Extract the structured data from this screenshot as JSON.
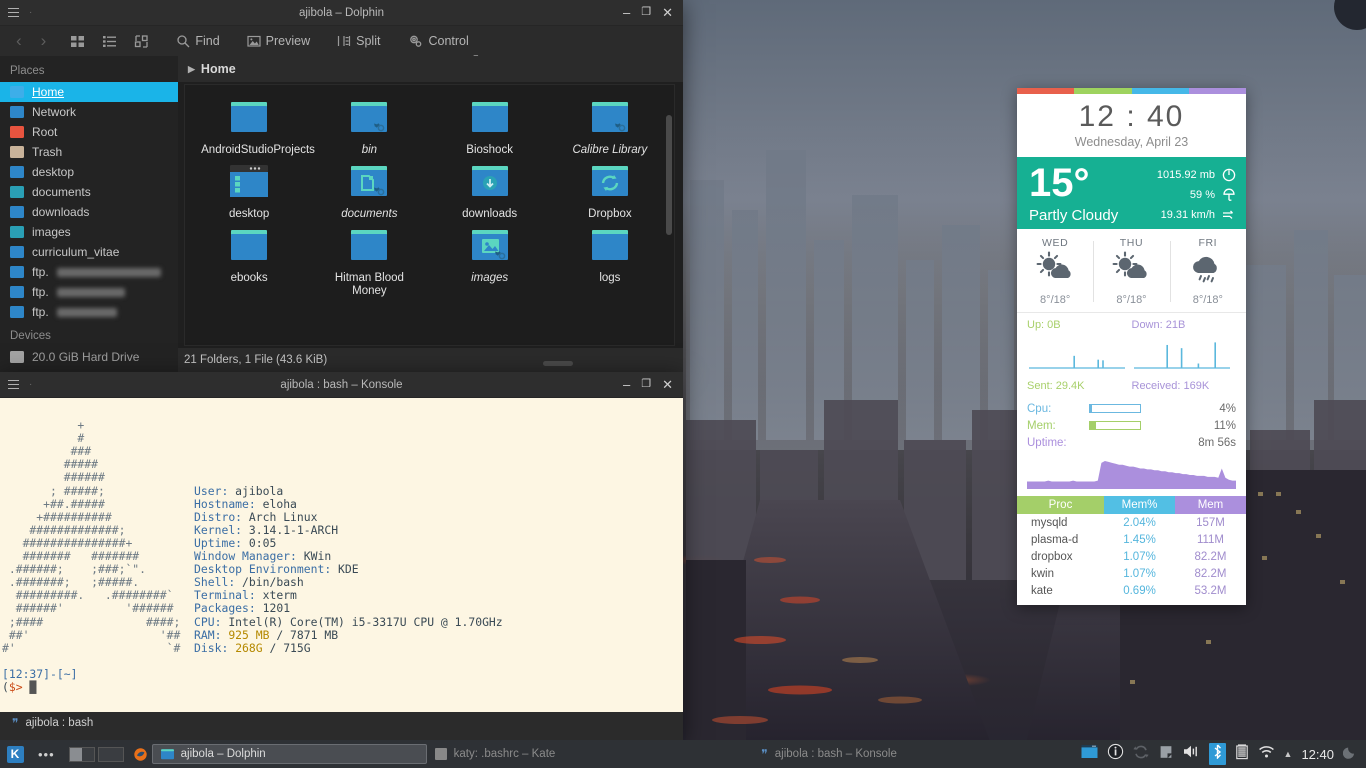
{
  "dolphin": {
    "title": "ajibola – Dolphin",
    "toolbar": {
      "back": "‹",
      "forward": "›",
      "icons_view": "grid-view-icon",
      "details_view": "details-view-icon",
      "sort_view": "sort-icon",
      "find": "Find",
      "preview": "Preview",
      "split": "Split",
      "control": "Control"
    },
    "breadcrumb": "Home",
    "places_header": "Places",
    "devices_header": "Devices",
    "places": [
      {
        "label": "Home",
        "color": "#3daee9",
        "selected": true
      },
      {
        "label": "Network",
        "color": "#2e86c8",
        "selected": false
      },
      {
        "label": "Root",
        "color": "#e8543f",
        "selected": false
      },
      {
        "label": "Trash",
        "color": "#c9b39a",
        "selected": false
      },
      {
        "label": "desktop",
        "color": "#2e86c8",
        "selected": false
      },
      {
        "label": "documents",
        "color": "#2a9fb5",
        "selected": false
      },
      {
        "label": "downloads",
        "color": "#2e86c8",
        "selected": false
      },
      {
        "label": "images",
        "color": "#2a9fb5",
        "selected": false
      },
      {
        "label": "curriculum_vitae",
        "color": "#2e86c8",
        "selected": false
      }
    ],
    "ftp_places": [
      {
        "label": "ftp.",
        "color": "#2e86c8",
        "redacted_width": 104
      },
      {
        "label": "ftp.",
        "color": "#2e86c8",
        "redacted_width": 68
      },
      {
        "label": "ftp.",
        "color": "#2e86c8",
        "redacted_width": 60
      }
    ],
    "device": {
      "label": "20.0 GiB Hard Drive"
    },
    "files": [
      {
        "name": "AndroidStudioProjects",
        "italic": false,
        "emblem": "none"
      },
      {
        "name": "bin",
        "italic": true,
        "emblem": "link"
      },
      {
        "name": "Bioshock",
        "italic": false,
        "emblem": "none"
      },
      {
        "name": "Calibre Library",
        "italic": true,
        "emblem": "link"
      },
      {
        "name": "desktop",
        "italic": false,
        "emblem": "desktop"
      },
      {
        "name": "documents",
        "italic": true,
        "emblem": "documents-link"
      },
      {
        "name": "downloads",
        "italic": false,
        "emblem": "download"
      },
      {
        "name": "Dropbox",
        "italic": false,
        "emblem": "sync"
      },
      {
        "name": "ebooks",
        "italic": false,
        "emblem": "none"
      },
      {
        "name": "Hitman Blood Money",
        "italic": false,
        "emblem": "none"
      },
      {
        "name": "images",
        "italic": true,
        "emblem": "images-link"
      },
      {
        "name": "logs",
        "italic": false,
        "emblem": "none"
      }
    ],
    "status": "21 Folders, 1 File (43.6 KiB)"
  },
  "konsole": {
    "title": "ajibola : bash – Konsole",
    "tab_label": "ajibola : bash",
    "sysinfo": {
      "User": "ajibola",
      "Hostname": "eloha",
      "Distro": "Arch Linux",
      "Kernel": "3.14.1-1-ARCH",
      "Uptime": "0:05",
      "Window Manager": "KWin",
      "Desktop Environment": "KDE",
      "Shell": "/bin/bash",
      "Terminal": "xterm",
      "Packages": "1201",
      "CPU": "Intel(R) Core(TM) i5-3317U CPU @ 1.70GHz",
      "RAM_used": "925 MB",
      "RAM_total": "7871 MB",
      "Disk_used": "268G",
      "Disk_total": "715G"
    },
    "prompt_time": "[12:37]-[~]",
    "prompt_sigil": "($> ",
    "ascii_art": [
      "           +",
      "           #",
      "          ###",
      "         #####",
      "         ######",
      "       ; #####;",
      "      +##.#####",
      "     +##########",
      "    #############;",
      "   ###############+",
      "   #######   #######",
      " .######;    ;###;`\".",
      " .#######;   ;#####.",
      "  #########.   .########`",
      "  ######'         '######",
      " ;####               ####;",
      " ##'                   '##",
      "#'                      `#"
    ]
  },
  "widget": {
    "accent_bar": [
      "#e8604c",
      "#9ed35f",
      "#45b8e8",
      "#ab8fdd"
    ],
    "clock": {
      "time": "12 : 40",
      "date": "Wednesday, April 23"
    },
    "weather": {
      "temperature": "15°",
      "condition": "Partly Cloudy",
      "pressure": "1015.92 mb",
      "humidity": "59 %",
      "wind": "19.31 km/h",
      "bg": "#16b093"
    },
    "forecast": [
      {
        "day": "WED",
        "icon": "sun-cloud-icon",
        "temps": "8°/18°"
      },
      {
        "day": "THU",
        "icon": "sun-cloud-icon",
        "temps": "8°/18°"
      },
      {
        "day": "FRI",
        "icon": "rain-cloud-icon",
        "temps": "8°/18°"
      }
    ],
    "network": {
      "up_label": "Up: 0B",
      "down_label": "Down: 21B",
      "sent_label": "Sent: 29.4K",
      "received_label": "Received: 169K",
      "up_spikes": [
        0,
        0,
        0,
        0,
        0,
        0,
        0,
        0,
        0,
        0,
        0,
        0,
        0,
        0,
        0,
        0,
        0,
        0,
        38,
        0,
        0,
        0,
        0,
        0,
        0,
        0,
        0,
        0,
        26,
        0,
        24,
        0,
        0,
        0,
        0,
        0,
        0,
        0,
        0,
        0
      ],
      "down_spikes": [
        0,
        0,
        0,
        0,
        0,
        0,
        0,
        0,
        0,
        0,
        0,
        0,
        0,
        72,
        0,
        0,
        0,
        0,
        0,
        62,
        0,
        0,
        0,
        0,
        0,
        0,
        14,
        0,
        0,
        0,
        0,
        0,
        0,
        80,
        0,
        0,
        0,
        0,
        0,
        0
      ]
    },
    "system": {
      "cpu_label": "Cpu:",
      "cpu_value": "4%",
      "cpu_pct": 4,
      "mem_label": "Mem:",
      "mem_value": "11%",
      "mem_pct": 11,
      "uptime_label": "Uptime:",
      "uptime_value": "8m 56s",
      "history": [
        8,
        8,
        8,
        8,
        8,
        8,
        9,
        8,
        8,
        8,
        8,
        8,
        8,
        9,
        8,
        8,
        8,
        8,
        8,
        8,
        9,
        28,
        30,
        29,
        28,
        27,
        26,
        26,
        25,
        24,
        24,
        23,
        22,
        22,
        21,
        21,
        20,
        20,
        19,
        19,
        18,
        18,
        17,
        17,
        16,
        16,
        15,
        15,
        14,
        14,
        14,
        13,
        13,
        13,
        12,
        22,
        12,
        10,
        9,
        9
      ]
    },
    "processes": {
      "headers": [
        "Proc",
        "Mem%",
        "Mem"
      ],
      "header_colors": [
        "#a4cf69",
        "#52bfe4",
        "#ab8fdd"
      ],
      "rows": [
        {
          "name": "mysqld",
          "pct": "2.04%",
          "mem": "157M"
        },
        {
          "name": "plasma-d",
          "pct": "1.45%",
          "mem": "111M"
        },
        {
          "name": "dropbox",
          "pct": "1.07%",
          "mem": "82.2M"
        },
        {
          "name": "kwin",
          "pct": "1.07%",
          "mem": "82.2M"
        },
        {
          "name": "kate",
          "pct": "0.69%",
          "mem": "53.2M"
        }
      ]
    }
  },
  "taskbar": {
    "menu_label": "K",
    "dots": "•••",
    "tasks": [
      {
        "label": "ajibola – Dolphin",
        "active": true,
        "icon": "folder-icon"
      },
      {
        "label": "katy: .bashrc – Kate",
        "active": false,
        "icon": "kate-icon"
      },
      {
        "label": "ajibola : bash – Konsole",
        "active": false,
        "icon": "konsole-icon"
      }
    ],
    "tray": [
      "clipboard-icon",
      "info-icon",
      "sync-icon",
      "device-icon",
      "volume-icon",
      "bluetooth-icon",
      "battery-icon",
      "wifi-icon",
      "expand-arrow-icon"
    ],
    "clock": "12:40"
  }
}
